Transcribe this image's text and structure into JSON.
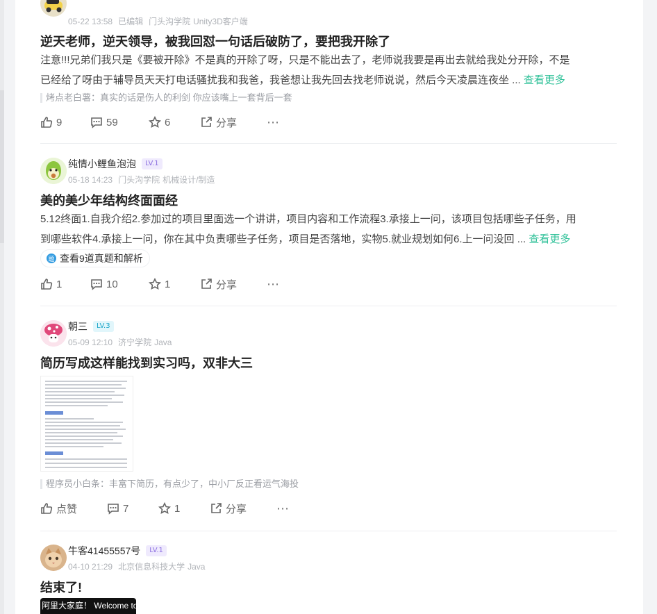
{
  "posts": [
    {
      "date": "05-22 13:58",
      "edited": "已编辑",
      "school": "门头沟学院",
      "role": "Unity3D客户端",
      "title": "逆天老师，逆天领导，被我回怼一句话后破防了，要把我开除了",
      "content_l1": "注意!!!兄弟们我只是《要被开除》不是真的开除了呀，只是不能出去了，老师说我要是再出去就给我处分开除，不是",
      "content_l2": "已经给了呀由于辅导员天天打电话骚扰我和我爸，我爸想让我先回去找老师说说，然后今天凌晨连夜坐 ...",
      "more": "查看更多",
      "comment": "烤点老白薯：真实的话是伤人的利剑 你应该嘴上一套背后一套",
      "likes": "9",
      "comments": "59",
      "stars": "6",
      "share": "分享"
    },
    {
      "name": "纯情小鲤鱼泡泡",
      "level": "LV.1",
      "date": "05-18 14:23",
      "school": "门头沟学院",
      "role": "机械设计/制造",
      "title": "美的美少年结构终面面经",
      "content_l1": "5.12终面1.自我介绍2.参加过的项目里面选一个讲讲，项目内容和工作流程3.承接上一问，该项目包括哪些子任务，用",
      "content_l2": "到哪些软件4.承接上一问，你在其中负责哪些子任务，项目是否落地，实物5.就业规划如何6.上一问没回 ...",
      "more": "查看更多",
      "tag_icon": "题",
      "tag": "查看9道真题和解析",
      "likes": "1",
      "comments": "10",
      "stars": "1",
      "share": "分享"
    },
    {
      "name": "朝三",
      "level": "LV.3",
      "date": "05-09 12:10",
      "school": "济宁学院",
      "role": "Java",
      "title": "简历写成这样能找到实习吗，双非大三",
      "comment": "程序员小白条：丰富下简历，有点少了，中小厂反正看运气海投",
      "likes": "点赞",
      "comments": "7",
      "stars": "1",
      "share": "分享"
    },
    {
      "name": "牛客41455557号",
      "level": "LV.1",
      "date": "04-10 21:29",
      "school": "北京信息科技大学",
      "role": "Java",
      "title": "结束了!",
      "video_text": "阿里大家庭！ Welcome to jo"
    }
  ],
  "more_icon": "⋯",
  "colors": {
    "accent": "#32c29a",
    "lv_purple": "#8b6ee0",
    "lv_cyan": "#1aa6c9"
  }
}
